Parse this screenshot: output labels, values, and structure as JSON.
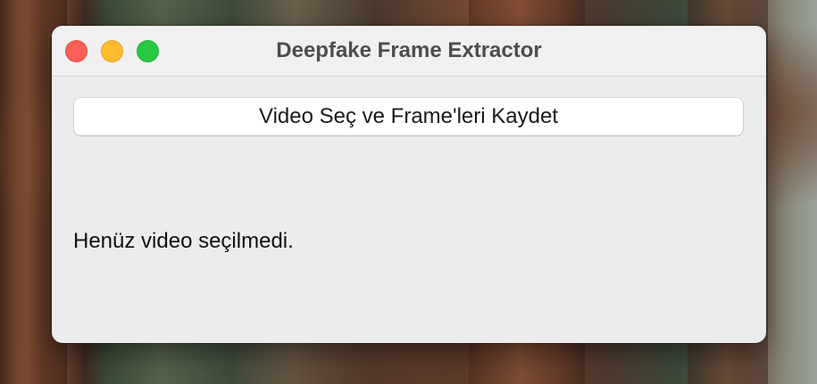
{
  "window": {
    "title": "Deepfake Frame Extractor"
  },
  "main": {
    "select_button_label": "Video Seç ve Frame'leri Kaydet",
    "status_text": "Henüz video seçilmedi."
  },
  "colors": {
    "close": "#fe5f57",
    "minimize": "#febc2e",
    "maximize": "#28c840"
  }
}
